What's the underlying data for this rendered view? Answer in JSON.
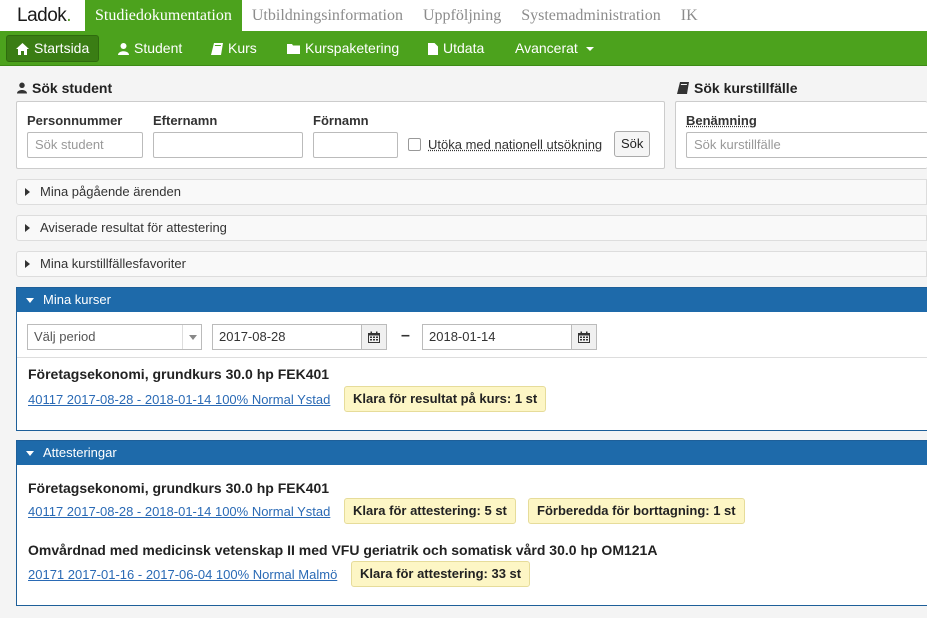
{
  "app": {
    "logo": "Ladok",
    "logo_dot": "."
  },
  "top_tabs": [
    {
      "label": "Studiedokumentation",
      "active": true
    },
    {
      "label": "Utbildningsinformation",
      "active": false
    },
    {
      "label": "Uppföljning",
      "active": false
    },
    {
      "label": "Systemadministration",
      "active": false
    },
    {
      "label": "IK",
      "active": false
    }
  ],
  "nav": {
    "startsida": "Startsida",
    "student": "Student",
    "kurs": "Kurs",
    "kurspaketering": "Kurspaketering",
    "utdata": "Utdata",
    "avancerat": "Avancerat"
  },
  "student_search": {
    "title": "Sök student",
    "personnummer_label": "Personnummer",
    "personnummer_placeholder": "Sök student",
    "efternamn_label": "Efternamn",
    "fornamn_label": "Förnamn",
    "national_label": "Utöka med nationell utsökning",
    "search_button": "Sök"
  },
  "course_search": {
    "title": "Sök kurstillfälle",
    "benamning_label": "Benämning",
    "placeholder": "Sök kurstillfälle"
  },
  "collapsed_sections": [
    "Mina pågående ärenden",
    "Aviserade resultat för attestering",
    "Mina kurstillfällesfavoriter"
  ],
  "mina_kurser": {
    "title": "Mina kurser",
    "period_placeholder": "Välj period",
    "date_from": "2017-08-28",
    "date_sep": "–",
    "date_to": "2018-01-14",
    "course_title": "Företagsekonomi, grundkurs 30.0 hp FEK401",
    "course_link": "40117 2017-08-28 - 2018-01-14 100% Normal Ystad",
    "badge": "Klara för resultat på kurs: 1 st"
  },
  "attesteringar": {
    "title": "Attesteringar",
    "items": [
      {
        "title": "Företagsekonomi, grundkurs 30.0 hp FEK401",
        "link": "40117 2017-08-28 - 2018-01-14 100% Normal Ystad",
        "badge1": "Klara för attestering: 5 st",
        "badge2": "Förberedda för borttagning: 1 st"
      },
      {
        "title": "Omvårdnad med medicinsk vetenskap II med VFU geriatrik och somatisk vård 30.0 hp OM121A",
        "link": "20171 2017-01-16 - 2017-06-04 100% Normal Malmö",
        "badge1": "Klara för attestering: 33 st"
      }
    ]
  },
  "colors": {
    "green": "#4ca21d",
    "blue": "#1e6aaa",
    "badge": "#fdf6c5",
    "link": "#2a6ab5"
  },
  "icons": [
    "home-icon",
    "user-icon",
    "book-icon",
    "folder-icon",
    "file-icon",
    "calendar-icon"
  ]
}
